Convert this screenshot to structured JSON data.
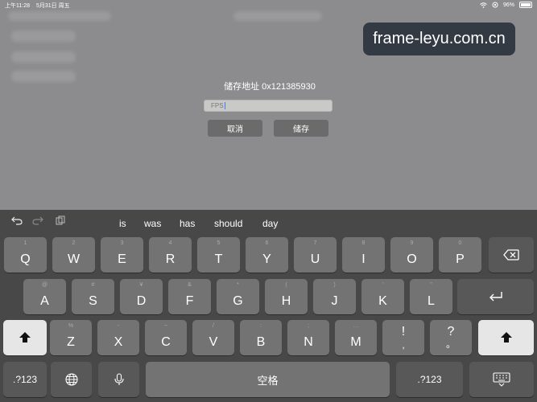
{
  "status": {
    "time": "上午11:28",
    "date": "5月31日 周五",
    "battery": "96%",
    "battery_level": 0.96
  },
  "watermark": "frame-leyu.com.cn",
  "dialog": {
    "title": "储存地址 0x121385930",
    "input_value": "FPS",
    "cancel": "取消",
    "save": "储存"
  },
  "suggestions": [
    "is",
    "was",
    "has",
    "should",
    "day"
  ],
  "keyboard": {
    "row1": [
      {
        "k": "Q",
        "s": "1"
      },
      {
        "k": "W",
        "s": "2"
      },
      {
        "k": "E",
        "s": "3"
      },
      {
        "k": "R",
        "s": "4"
      },
      {
        "k": "T",
        "s": "5"
      },
      {
        "k": "Y",
        "s": "6"
      },
      {
        "k": "U",
        "s": "7"
      },
      {
        "k": "I",
        "s": "8"
      },
      {
        "k": "O",
        "s": "9"
      },
      {
        "k": "P",
        "s": "0"
      }
    ],
    "row2": [
      {
        "k": "A",
        "s": "@"
      },
      {
        "k": "S",
        "s": "#"
      },
      {
        "k": "D",
        "s": "¥"
      },
      {
        "k": "F",
        "s": "&"
      },
      {
        "k": "G",
        "s": "*"
      },
      {
        "k": "H",
        "s": "("
      },
      {
        "k": "J",
        "s": ")"
      },
      {
        "k": "K",
        "s": "'"
      },
      {
        "k": "L",
        "s": "\""
      }
    ],
    "row3": [
      {
        "k": "Z",
        "s": "%"
      },
      {
        "k": "X",
        "s": "-"
      },
      {
        "k": "C",
        "s": "~"
      },
      {
        "k": "V",
        "s": "/"
      },
      {
        "k": "B",
        "s": ":"
      },
      {
        "k": "N",
        "s": ";"
      },
      {
        "k": "M",
        "s": "…"
      },
      {
        "k": "!",
        "s": ""
      },
      {
        "k": "?",
        "s": ""
      }
    ],
    "comma": ",",
    "period": "。",
    "numbers_label": ".?123",
    "space_label": "空格"
  },
  "icons": {
    "undo": "undo-icon",
    "redo": "redo-icon",
    "paste": "paste-icon",
    "delete": "delete-icon",
    "return": "return-icon",
    "shift": "shift-icon",
    "globe": "globe-icon",
    "mic": "microphone-icon",
    "hide_keyboard": "keyboard-hide-icon"
  }
}
